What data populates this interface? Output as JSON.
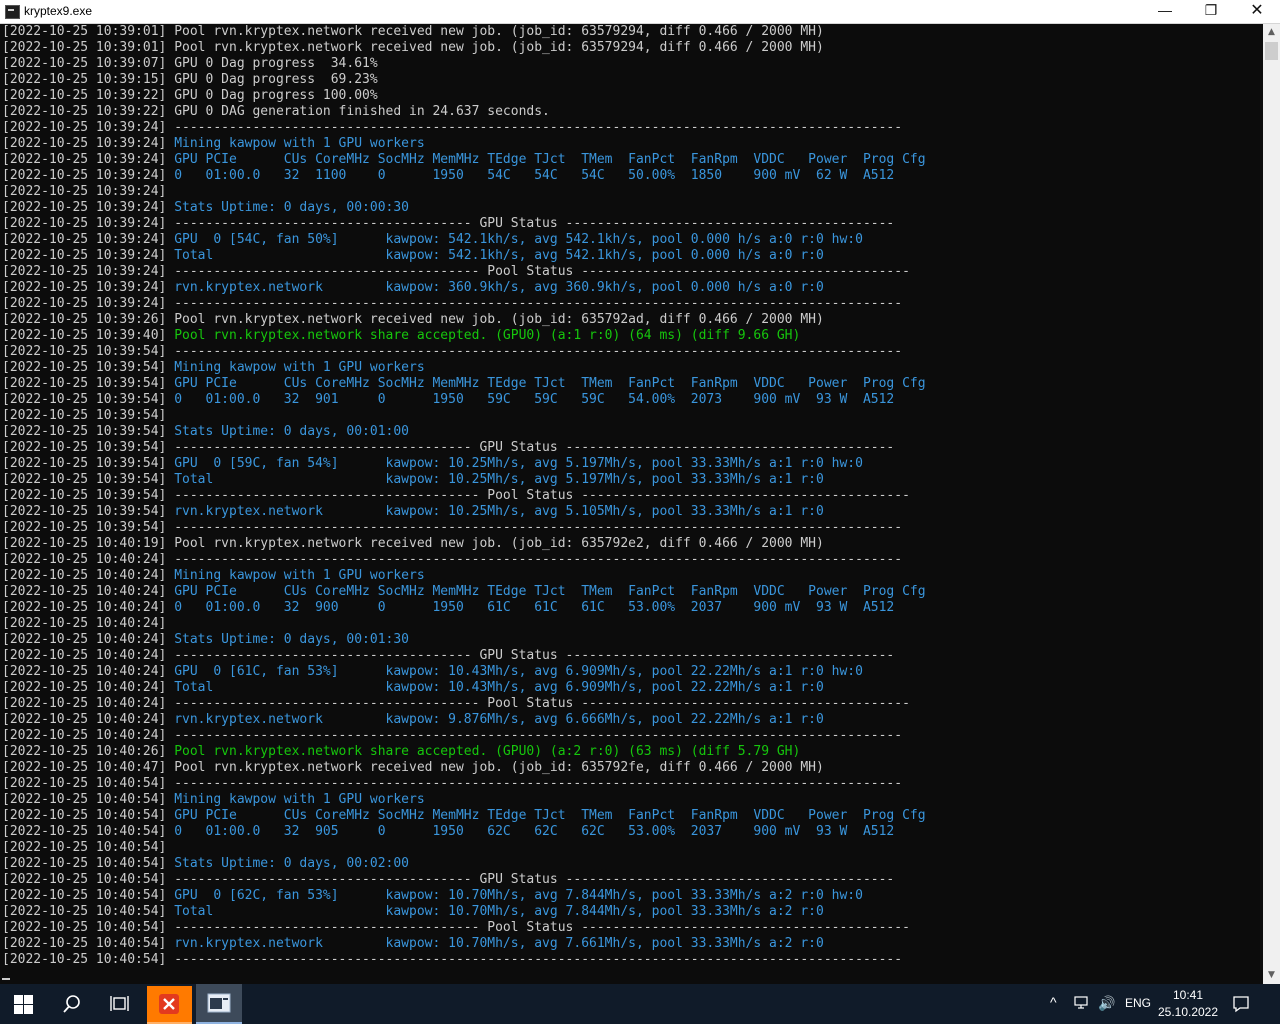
{
  "window": {
    "title": "kryptex9.exe",
    "controls": {
      "minimize": "—",
      "maximize": "❐",
      "close": "✕"
    }
  },
  "console": {
    "lines": [
      {
        "ts": "[2022-10-25 10:39:01]",
        "text": " Pool rvn.kryptex.network received new job. (job_id: 63579294, diff 0.466 / 2000 MH)",
        "color": "white"
      },
      {
        "ts": "[2022-10-25 10:39:01]",
        "text": " Pool rvn.kryptex.network received new job. (job_id: 63579294, diff 0.466 / 2000 MH)",
        "color": "white"
      },
      {
        "ts": "[2022-10-25 10:39:07]",
        "text": " GPU 0 Dag progress  34.61%",
        "color": "white"
      },
      {
        "ts": "[2022-10-25 10:39:15]",
        "text": " GPU 0 Dag progress  69.23%",
        "color": "white"
      },
      {
        "ts": "[2022-10-25 10:39:22]",
        "text": " GPU 0 Dag progress 100.00%",
        "color": "white"
      },
      {
        "ts": "[2022-10-25 10:39:22]",
        "text": " GPU 0 DAG generation finished in 24.637 seconds.",
        "color": "white"
      },
      {
        "ts": "[2022-10-25 10:39:24]",
        "text": " ---------------------------------------------------------------------------------------------",
        "color": "white"
      },
      {
        "ts": "[2022-10-25 10:39:24]",
        "text": " Mining kawpow with 1 GPU workers",
        "color": "cyan"
      },
      {
        "ts": "[2022-10-25 10:39:24]",
        "text": " GPU PCIe      CUs CoreMHz SocMHz MemMHz TEdge TJct  TMem  FanPct  FanRpm  VDDC   Power  Prog Cfg",
        "color": "cyan"
      },
      {
        "ts": "[2022-10-25 10:39:24]",
        "text": " 0   01:00.0   32  1100    0      1950   54C   54C   54C   50.00%  1850    900 mV  62 W  A512",
        "color": "cyan"
      },
      {
        "ts": "[2022-10-25 10:39:24]",
        "text": "",
        "color": "white"
      },
      {
        "ts": "[2022-10-25 10:39:24]",
        "text": " Stats Uptime: 0 days, 00:00:30",
        "color": "cyan"
      },
      {
        "ts": "[2022-10-25 10:39:24]",
        "text": " -------------------------------------- GPU Status ------------------------------------------",
        "color": "white"
      },
      {
        "ts": "[2022-10-25 10:39:24]",
        "text": " GPU  0 [54C, fan 50%]      kawpow: 542.1kh/s, avg 542.1kh/s, pool 0.000 h/s a:0 r:0 hw:0",
        "color": "cyan"
      },
      {
        "ts": "[2022-10-25 10:39:24]",
        "text": " Total                      kawpow: 542.1kh/s, avg 542.1kh/s, pool 0.000 h/s a:0 r:0",
        "color": "cyan"
      },
      {
        "ts": "[2022-10-25 10:39:24]",
        "text": " --------------------------------------- Pool Status ------------------------------------------",
        "color": "white"
      },
      {
        "ts": "[2022-10-25 10:39:24]",
        "text": " rvn.kryptex.network        kawpow: 360.9kh/s, avg 360.9kh/s, pool 0.000 h/s a:0 r:0",
        "color": "cyan"
      },
      {
        "ts": "[2022-10-25 10:39:24]",
        "text": " ---------------------------------------------------------------------------------------------",
        "color": "white"
      },
      {
        "ts": "[2022-10-25 10:39:26]",
        "text": " Pool rvn.kryptex.network received new job. (job_id: 635792ad, diff 0.466 / 2000 MH)",
        "color": "white"
      },
      {
        "ts": "[2022-10-25 10:39:40]",
        "text": " Pool rvn.kryptex.network share accepted. (GPU0) (a:1 r:0) (64 ms) (diff 9.66 GH)",
        "color": "green"
      },
      {
        "ts": "[2022-10-25 10:39:54]",
        "text": " ---------------------------------------------------------------------------------------------",
        "color": "white"
      },
      {
        "ts": "[2022-10-25 10:39:54]",
        "text": " Mining kawpow with 1 GPU workers",
        "color": "cyan"
      },
      {
        "ts": "[2022-10-25 10:39:54]",
        "text": " GPU PCIe      CUs CoreMHz SocMHz MemMHz TEdge TJct  TMem  FanPct  FanRpm  VDDC   Power  Prog Cfg",
        "color": "cyan"
      },
      {
        "ts": "[2022-10-25 10:39:54]",
        "text": " 0   01:00.0   32  901     0      1950   59C   59C   59C   54.00%  2073    900 mV  93 W  A512",
        "color": "cyan"
      },
      {
        "ts": "[2022-10-25 10:39:54]",
        "text": "",
        "color": "white"
      },
      {
        "ts": "[2022-10-25 10:39:54]",
        "text": " Stats Uptime: 0 days, 00:01:00",
        "color": "cyan"
      },
      {
        "ts": "[2022-10-25 10:39:54]",
        "text": " -------------------------------------- GPU Status ------------------------------------------",
        "color": "white"
      },
      {
        "ts": "[2022-10-25 10:39:54]",
        "text": " GPU  0 [59C, fan 54%]      kawpow: 10.25Mh/s, avg 5.197Mh/s, pool 33.33Mh/s a:1 r:0 hw:0",
        "color": "cyan"
      },
      {
        "ts": "[2022-10-25 10:39:54]",
        "text": " Total                      kawpow: 10.25Mh/s, avg 5.197Mh/s, pool 33.33Mh/s a:1 r:0",
        "color": "cyan"
      },
      {
        "ts": "[2022-10-25 10:39:54]",
        "text": " --------------------------------------- Pool Status ------------------------------------------",
        "color": "white"
      },
      {
        "ts": "[2022-10-25 10:39:54]",
        "text": " rvn.kryptex.network        kawpow: 10.25Mh/s, avg 5.105Mh/s, pool 33.33Mh/s a:1 r:0",
        "color": "cyan"
      },
      {
        "ts": "[2022-10-25 10:39:54]",
        "text": " ---------------------------------------------------------------------------------------------",
        "color": "white"
      },
      {
        "ts": "[2022-10-25 10:40:19]",
        "text": " Pool rvn.kryptex.network received new job. (job_id: 635792e2, diff 0.466 / 2000 MH)",
        "color": "white"
      },
      {
        "ts": "[2022-10-25 10:40:24]",
        "text": " ---------------------------------------------------------------------------------------------",
        "color": "white"
      },
      {
        "ts": "[2022-10-25 10:40:24]",
        "text": " Mining kawpow with 1 GPU workers",
        "color": "cyan"
      },
      {
        "ts": "[2022-10-25 10:40:24]",
        "text": " GPU PCIe      CUs CoreMHz SocMHz MemMHz TEdge TJct  TMem  FanPct  FanRpm  VDDC   Power  Prog Cfg",
        "color": "cyan"
      },
      {
        "ts": "[2022-10-25 10:40:24]",
        "text": " 0   01:00.0   32  900     0      1950   61C   61C   61C   53.00%  2037    900 mV  93 W  A512",
        "color": "cyan"
      },
      {
        "ts": "[2022-10-25 10:40:24]",
        "text": "",
        "color": "white"
      },
      {
        "ts": "[2022-10-25 10:40:24]",
        "text": " Stats Uptime: 0 days, 00:01:30",
        "color": "cyan"
      },
      {
        "ts": "[2022-10-25 10:40:24]",
        "text": " -------------------------------------- GPU Status ------------------------------------------",
        "color": "white"
      },
      {
        "ts": "[2022-10-25 10:40:24]",
        "text": " GPU  0 [61C, fan 53%]      kawpow: 10.43Mh/s, avg 6.909Mh/s, pool 22.22Mh/s a:1 r:0 hw:0",
        "color": "cyan"
      },
      {
        "ts": "[2022-10-25 10:40:24]",
        "text": " Total                      kawpow: 10.43Mh/s, avg 6.909Mh/s, pool 22.22Mh/s a:1 r:0",
        "color": "cyan"
      },
      {
        "ts": "[2022-10-25 10:40:24]",
        "text": " --------------------------------------- Pool Status ------------------------------------------",
        "color": "white"
      },
      {
        "ts": "[2022-10-25 10:40:24]",
        "text": " rvn.kryptex.network        kawpow: 9.876Mh/s, avg 6.666Mh/s, pool 22.22Mh/s a:1 r:0",
        "color": "cyan"
      },
      {
        "ts": "[2022-10-25 10:40:24]",
        "text": " ---------------------------------------------------------------------------------------------",
        "color": "white"
      },
      {
        "ts": "[2022-10-25 10:40:26]",
        "text": " Pool rvn.kryptex.network share accepted. (GPU0) (a:2 r:0) (63 ms) (diff 5.79 GH)",
        "color": "green"
      },
      {
        "ts": "[2022-10-25 10:40:47]",
        "text": " Pool rvn.kryptex.network received new job. (job_id: 635792fe, diff 0.466 / 2000 MH)",
        "color": "white"
      },
      {
        "ts": "[2022-10-25 10:40:54]",
        "text": " ---------------------------------------------------------------------------------------------",
        "color": "white"
      },
      {
        "ts": "[2022-10-25 10:40:54]",
        "text": " Mining kawpow with 1 GPU workers",
        "color": "cyan"
      },
      {
        "ts": "[2022-10-25 10:40:54]",
        "text": " GPU PCIe      CUs CoreMHz SocMHz MemMHz TEdge TJct  TMem  FanPct  FanRpm  VDDC   Power  Prog Cfg",
        "color": "cyan"
      },
      {
        "ts": "[2022-10-25 10:40:54]",
        "text": " 0   01:00.0   32  905     0      1950   62C   62C   62C   53.00%  2037    900 mV  93 W  A512",
        "color": "cyan"
      },
      {
        "ts": "[2022-10-25 10:40:54]",
        "text": "",
        "color": "white"
      },
      {
        "ts": "[2022-10-25 10:40:54]",
        "text": " Stats Uptime: 0 days, 00:02:00",
        "color": "cyan"
      },
      {
        "ts": "[2022-10-25 10:40:54]",
        "text": " -------------------------------------- GPU Status ------------------------------------------",
        "color": "white"
      },
      {
        "ts": "[2022-10-25 10:40:54]",
        "text": " GPU  0 [62C, fan 53%]      kawpow: 10.70Mh/s, avg 7.844Mh/s, pool 33.33Mh/s a:2 r:0 hw:0",
        "color": "cyan"
      },
      {
        "ts": "[2022-10-25 10:40:54]",
        "text": " Total                      kawpow: 10.70Mh/s, avg 7.844Mh/s, pool 33.33Mh/s a:2 r:0",
        "color": "cyan"
      },
      {
        "ts": "[2022-10-25 10:40:54]",
        "text": " --------------------------------------- Pool Status ------------------------------------------",
        "color": "white"
      },
      {
        "ts": "[2022-10-25 10:40:54]",
        "text": " rvn.kryptex.network        kawpow: 10.70Mh/s, avg 7.661Mh/s, pool 33.33Mh/s a:2 r:0",
        "color": "cyan"
      },
      {
        "ts": "[2022-10-25 10:40:54]",
        "text": " ---------------------------------------------------------------------------------------------",
        "color": "white"
      }
    ]
  },
  "scrollbar": {
    "up_arrow": "▲",
    "down_arrow": "▼"
  },
  "taskbar": {
    "apps": [
      {
        "name": "kryptex",
        "icon": "kryptex-icon"
      },
      {
        "name": "console",
        "icon": "console-icon"
      }
    ],
    "tray": {
      "chevron": "^",
      "volume": "🔊",
      "language": "ENG",
      "time": "10:41",
      "date": "25.10.2022"
    }
  },
  "colors": {
    "console_bg": "#0c0c0c",
    "text_white": "#cccccc",
    "text_cyan": "#3a96dd",
    "text_green": "#16c60c",
    "taskbar_bg": "#101b29",
    "kryptex_orange": "#ff7a00"
  }
}
